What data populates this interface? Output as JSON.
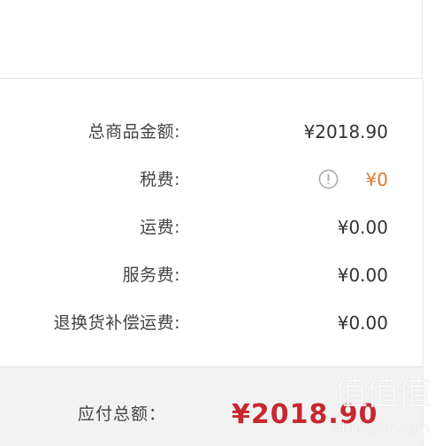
{
  "summary": {
    "rows": [
      {
        "label": "总商品金额:",
        "value": "¥2018.90"
      },
      {
        "label": "税费:",
        "value": "¥0",
        "icon": "info-icon"
      },
      {
        "label": "运费:",
        "value": "¥0.00"
      },
      {
        "label": "服务费:",
        "value": "¥0.00"
      },
      {
        "label": "退换货补偿运费:",
        "value": "¥0.00"
      }
    ]
  },
  "total": {
    "label": "应付总额：",
    "value": "¥2018.90"
  },
  "watermark": {
    "logo": "值值值",
    "text": "zhizhizhi.com"
  },
  "colors": {
    "accent_orange": "#e0782b",
    "total_red": "#c7272e",
    "band_gray": "#f2f2f2"
  }
}
